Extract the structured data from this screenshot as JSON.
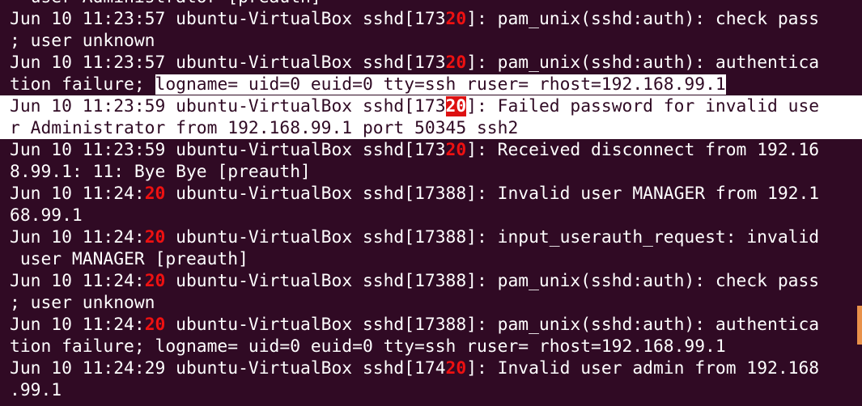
{
  "window": {
    "bg": "#300a24",
    "highlight": "#ee1111",
    "selection": "#ffffff"
  },
  "lines": [
    {
      "selected": false,
      "segments": [
        {
          "t": "  user Administrator [preauth]",
          "h": false
        }
      ]
    },
    {
      "selected": false,
      "segments": [
        {
          "t": "Jun 10 11:23:57 ubuntu-VirtualBox sshd[173",
          "h": false
        },
        {
          "t": "20",
          "h": true
        },
        {
          "t": "]: pam_unix(sshd:auth): check pass",
          "h": false
        }
      ]
    },
    {
      "selected": false,
      "segments": [
        {
          "t": "; user unknown",
          "h": false
        }
      ]
    },
    {
      "selected": false,
      "segments": [
        {
          "t": "Jun 10 11:23:57 ubuntu-VirtualBox sshd[173",
          "h": false
        },
        {
          "t": "20",
          "h": true
        },
        {
          "t": "]: pam_unix(sshd:auth): authentica",
          "h": false
        }
      ]
    },
    {
      "selected": "partial",
      "segments": [
        {
          "t": "tion failure; logname= uid=0 euid=0 tty=ssh ruser= rhost=192.168.99.1",
          "h": false
        }
      ]
    },
    {
      "selected": true,
      "segments": [
        {
          "t": "Jun 10 11:23:59 ubuntu-VirtualBox sshd[173",
          "h": false
        },
        {
          "t": "20",
          "h": "box"
        },
        {
          "t": "]: Failed password for invalid use",
          "h": false
        }
      ]
    },
    {
      "selected": true,
      "segments": [
        {
          "t": "r Administrator from 192.168.99.1 port 50345 ssh2",
          "h": false
        }
      ]
    },
    {
      "selected": false,
      "segments": [
        {
          "t": "Jun 10 11:23:59 ubuntu-VirtualBox sshd[173",
          "h": false
        },
        {
          "t": "20",
          "h": true
        },
        {
          "t": "]: Received disconnect from 192.16",
          "h": false
        }
      ]
    },
    {
      "selected": false,
      "segments": [
        {
          "t": "8.99.1: 11: Bye Bye [preauth]",
          "h": false
        }
      ]
    },
    {
      "selected": false,
      "segments": [
        {
          "t": "Jun 10 11:24:",
          "h": false
        },
        {
          "t": "20",
          "h": true
        },
        {
          "t": " ubuntu-VirtualBox sshd[17388]: Invalid user MANAGER from 192.1",
          "h": false
        }
      ]
    },
    {
      "selected": false,
      "segments": [
        {
          "t": "68.99.1",
          "h": false
        }
      ]
    },
    {
      "selected": false,
      "segments": [
        {
          "t": "Jun 10 11:24:",
          "h": false
        },
        {
          "t": "20",
          "h": true
        },
        {
          "t": " ubuntu-VirtualBox sshd[17388]: input_userauth_request: invalid",
          "h": false
        }
      ]
    },
    {
      "selected": false,
      "segments": [
        {
          "t": " user MANAGER [preauth]",
          "h": false
        }
      ]
    },
    {
      "selected": false,
      "segments": [
        {
          "t": "Jun 10 11:24:",
          "h": false
        },
        {
          "t": "20",
          "h": true
        },
        {
          "t": " ubuntu-VirtualBox sshd[17388]: pam_unix(sshd:auth): check pass",
          "h": false
        }
      ]
    },
    {
      "selected": false,
      "segments": [
        {
          "t": "; user unknown",
          "h": false
        }
      ]
    },
    {
      "selected": false,
      "segments": [
        {
          "t": "Jun 10 11:24:",
          "h": false
        },
        {
          "t": "20",
          "h": true
        },
        {
          "t": " ubuntu-VirtualBox sshd[17388]: pam_unix(sshd:auth): authentica",
          "h": false
        }
      ]
    },
    {
      "selected": false,
      "segments": [
        {
          "t": "tion failure; logname= uid=0 euid=0 tty=ssh ruser= rhost=192.168.99.1",
          "h": false
        }
      ]
    },
    {
      "selected": false,
      "segments": [
        {
          "t": "Jun 10 11:24:29 ubuntu-VirtualBox sshd[174",
          "h": false
        },
        {
          "t": "20",
          "h": true
        },
        {
          "t": "]: Invalid user admin from 192.168",
          "h": false
        }
      ]
    },
    {
      "selected": false,
      "segments": [
        {
          "t": ".99.1",
          "h": false
        }
      ]
    }
  ]
}
